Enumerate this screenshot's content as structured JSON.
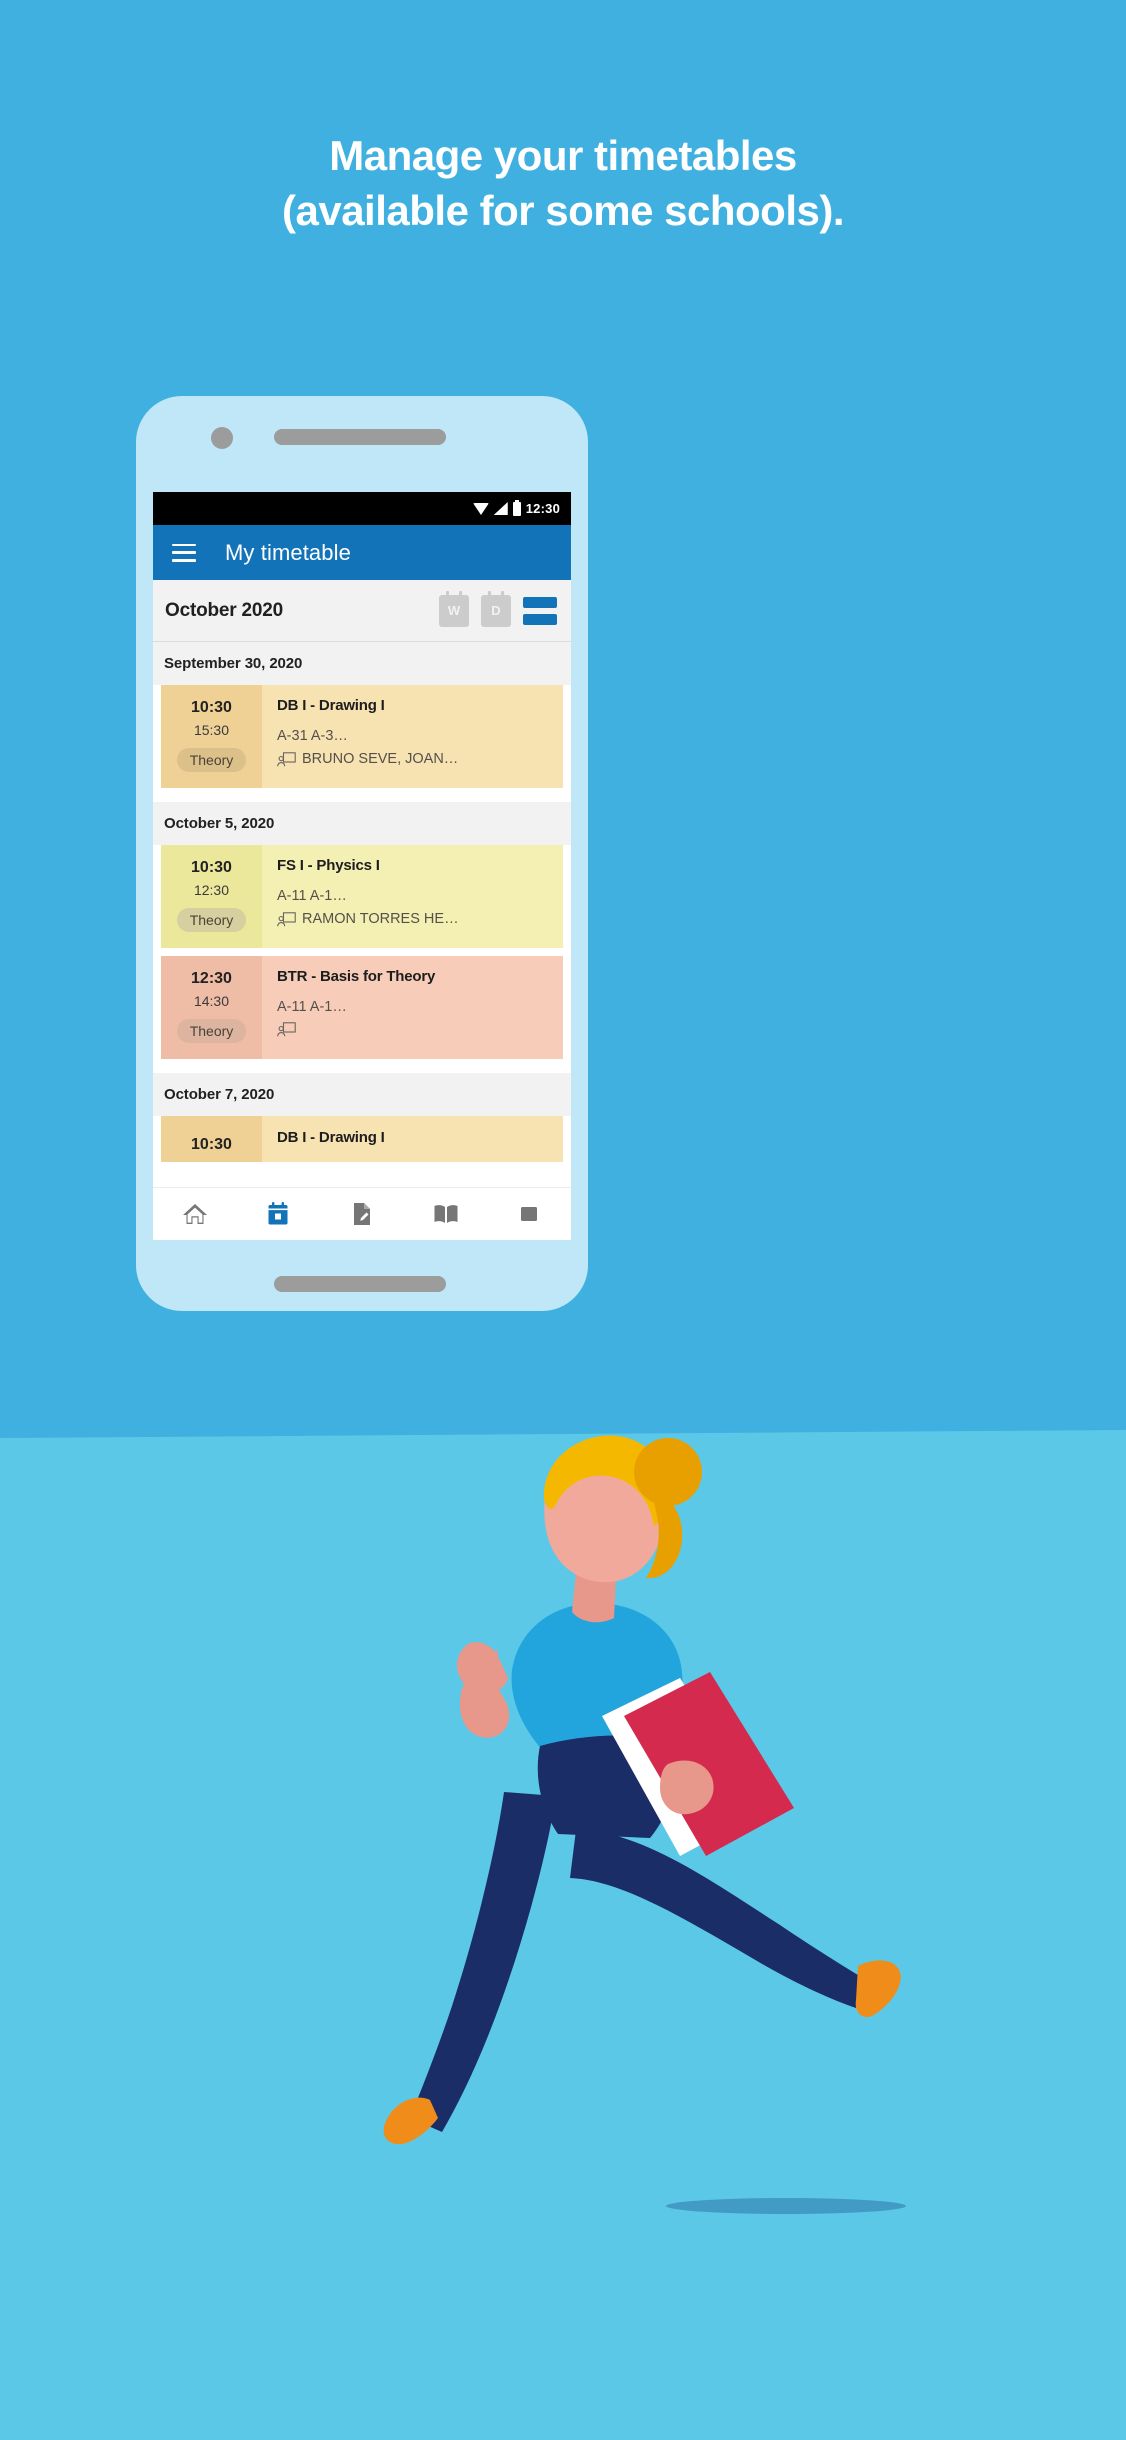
{
  "theme": {
    "bg_top": "#3FB0DF",
    "bg_bottom": "#5BC8E8",
    "phone_frame": "#BFE7F7",
    "appbar_blue": "#1273B8",
    "accent_blue": "#1273B8",
    "shirt_blue": "#22A5DC",
    "pants_navy": "#1B2D66",
    "book_red": "#D32A4E",
    "hair_yellow": "#F5B800",
    "skin": "#F0A99A",
    "shoe_orange": "#F08C19"
  },
  "headline": {
    "line1": "Manage your timetables",
    "line2": "(available for some schools)."
  },
  "phone": {
    "status_bar": {
      "time": "12:30",
      "icons": [
        "wifi-icon",
        "signal-icon",
        "battery-icon"
      ]
    },
    "app_bar": {
      "menu_icon": "hamburger-menu-icon",
      "title": "My timetable"
    },
    "month_bar": {
      "month_label": "October 2020",
      "views": [
        {
          "name": "week-view",
          "label": "W",
          "active": false
        },
        {
          "name": "day-view",
          "label": "D",
          "active": false
        },
        {
          "name": "list-view",
          "label": "",
          "active": true
        }
      ]
    },
    "days": [
      {
        "date_label": "September 30, 2020",
        "events": [
          {
            "start": "10:30",
            "end": "15:30",
            "chip": "Theory",
            "title": "DB I - Drawing I",
            "room": "A-31 A-3…",
            "teacher": "BRUNO SEVE, JOAN…",
            "bg": "#F7E2B2",
            "time_bg": "#EFD196",
            "chip_bg": "#DCC08A"
          }
        ]
      },
      {
        "date_label": "October 5, 2020",
        "events": [
          {
            "start": "10:30",
            "end": "12:30",
            "chip": "Theory",
            "title": "FS I - Physics I",
            "room": "A-11 A-1…",
            "teacher": "RAMON TORRES HE…",
            "bg": "#F4F0B4",
            "time_bg": "#EBE79B",
            "chip_bg": "#D6CFA0"
          },
          {
            "start": "12:30",
            "end": "14:30",
            "chip": "Theory",
            "title": "BTR - Basis for Theory",
            "room": "A-11 A-1…",
            "teacher": "",
            "bg": "#F7CDBA",
            "time_bg": "#EFBCA6",
            "chip_bg": "#DCB49F"
          }
        ]
      },
      {
        "date_label": "October 7, 2020",
        "events": [
          {
            "start": "10:30",
            "end": "",
            "chip": "",
            "title": "DB I - Drawing I",
            "room": "",
            "teacher": "",
            "bg": "#F7E2B2",
            "time_bg": "#EFD196",
            "chip_bg": "#DCC08A"
          }
        ]
      }
    ],
    "bottom_nav": [
      {
        "name": "nav-home",
        "icon": "home-icon",
        "active": false
      },
      {
        "name": "nav-calendar",
        "icon": "calendar-icon",
        "active": true
      },
      {
        "name": "nav-documents",
        "icon": "document-edit-icon",
        "active": false
      },
      {
        "name": "nav-library",
        "icon": "open-book-icon",
        "active": false
      },
      {
        "name": "nav-more",
        "icon": "more-icon",
        "active": false
      }
    ]
  },
  "illustration": {
    "subject": "running-student-with-book"
  }
}
